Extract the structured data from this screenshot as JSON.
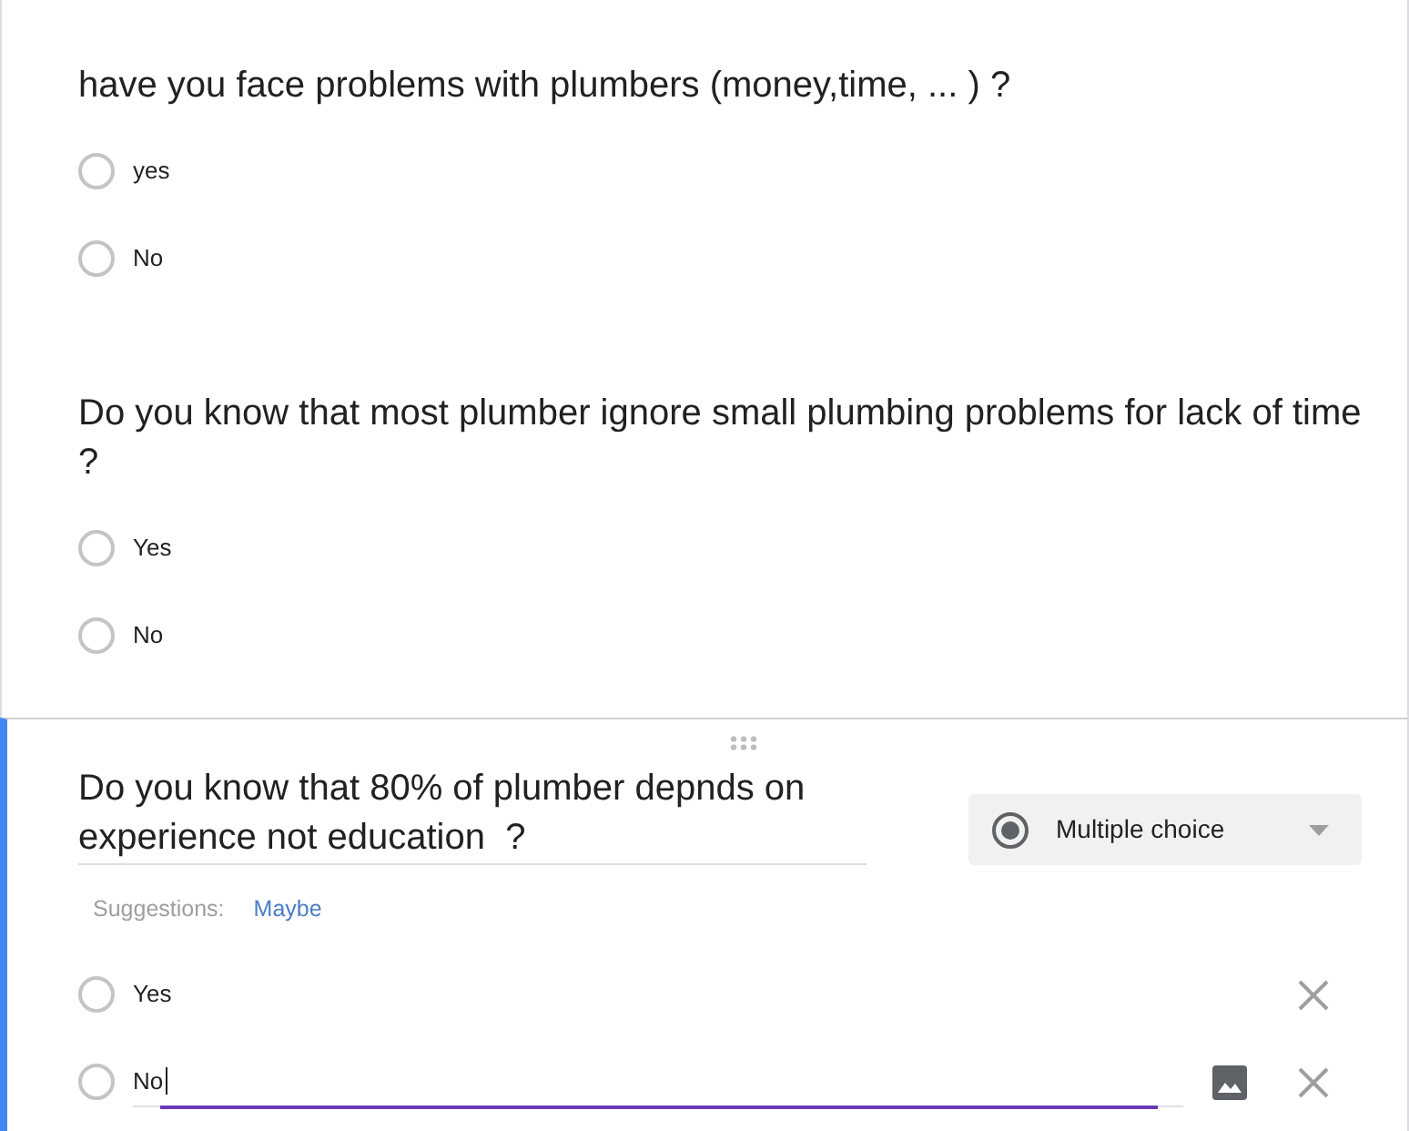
{
  "questions": [
    {
      "title": "have you face problems with plumbers (money,time, ... ) ?",
      "options": [
        {
          "label": "yes",
          "selected": false
        },
        {
          "label": "No",
          "selected": false
        }
      ]
    },
    {
      "title": "Do you know that most plumber ignore small plumbing problems for lack of time ?",
      "options": [
        {
          "label": "Yes",
          "selected": false
        },
        {
          "label": "No",
          "selected": false
        }
      ]
    }
  ],
  "active_question": {
    "title": "Do you know that 80% of plumber depnds on experience not education  ?",
    "question_type": "Multiple choice",
    "suggestions": {
      "label": "Suggestions:",
      "items": [
        "Maybe"
      ]
    },
    "options": [
      {
        "label": "Yes",
        "selected": false,
        "focused": false
      },
      {
        "label": "No",
        "selected": false,
        "focused": true
      }
    ]
  }
}
